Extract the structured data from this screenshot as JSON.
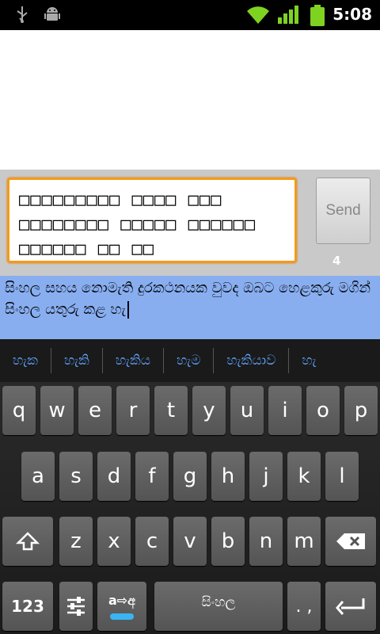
{
  "status": {
    "time": "5:08",
    "icons": [
      "usb-icon",
      "android-debug-icon",
      "wifi-icon",
      "signal-icon",
      "battery-icon"
    ]
  },
  "compose": {
    "message_text": "□□□□□□□□□ □□□□ □□□ □□□□□□□□ □□□□□ □□□□□□ □□□□□□ □□ □□",
    "send_label": "Send",
    "char_counter": "4"
  },
  "composing_text": "සිංහල සහය නොමැති දුරකථනයක වුවද ඔබට හෙළකුරු මගින් සිංහල යතුරු කළ හැ",
  "suggestions": [
    "හැක",
    "හැකි",
    "හැකිය",
    "හැම",
    "හැකියාව",
    "හැ"
  ],
  "keyboard": {
    "row1": [
      "q",
      "w",
      "e",
      "r",
      "t",
      "y",
      "u",
      "i",
      "o",
      "p"
    ],
    "row2": [
      "a",
      "s",
      "d",
      "f",
      "g",
      "h",
      "j",
      "k",
      "l"
    ],
    "row3": [
      "z",
      "x",
      "c",
      "v",
      "b",
      "n",
      "m"
    ],
    "numbers_key": "123",
    "settings_key": "⚙",
    "lang_switch_key": "a⇨අ",
    "space_label": "සිංහල",
    "punct_key": ". ,",
    "enter_key": "↵"
  },
  "colors": {
    "accent_orange": "#f39a1c",
    "composing_bg": "#88aef0",
    "suggestion_text": "#5ea3ff"
  }
}
